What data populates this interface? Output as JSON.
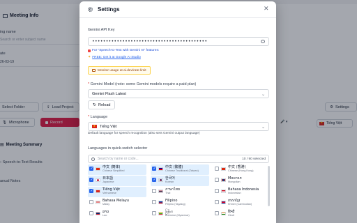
{
  "background": {
    "title": "Meeting Info",
    "name_label": "ing name",
    "name_placeholder": "Search or enter subject name",
    "date_label": "ate",
    "date_value": "26-03-19",
    "select_folder_label": "Select Folder",
    "load_project_label": "Load Project",
    "microphone_label": "Microphone",
    "record_label": "Record",
    "settings_label": "Settings",
    "language_value": "Tiếng Việt",
    "summary_label": "Meeting Summary",
    "stt_label": "Speech-to-Text Results",
    "notes_label": "anual Notes"
  },
  "dialog": {
    "title": "Settings",
    "close_icon": "close-icon",
    "api_key_label": "Gemini API Key",
    "api_key_value": "••••••••••••••••••••••••••••••••••••••••••",
    "api_note_1": "For \"Speech-to-Text with Gemini AI\" features:",
    "api_note_2": "FREE: Get it at Google AI Studio",
    "usage_label": "Monitor usage at ai.dev/rate-limit",
    "model_label": "Gemini Model (note: some Gemini models require a paid plan)",
    "model_value": "Gemini Flash Latest",
    "reload_label": "Reload",
    "language_label": "Language",
    "language_value": "Tiếng Việt",
    "language_hint": "Default language for speech recognition (also sets Gemini output language)",
    "quick_switch_label": "Languages in quick-switch selector",
    "search_placeholder": "Search by name or code...",
    "selected_count": "10 / 90 selected",
    "languages": [
      {
        "name": "中文 (简体)",
        "sub": "Chinese Simplified",
        "selected": true,
        "flag": "cn"
      },
      {
        "name": "中文 (繁體)",
        "sub": "Chinese Traditional (Taiwan)",
        "selected": true,
        "flag": "tw"
      },
      {
        "name": "中文 (香港)",
        "sub": "Chinese (Hong Kong)",
        "selected": false,
        "flag": "hk"
      },
      {
        "name": "日本語",
        "sub": "Japanese",
        "selected": true,
        "flag": "jp"
      },
      {
        "name": "한국어",
        "sub": "Korean",
        "selected": true,
        "flag": "kr"
      },
      {
        "name": "Монгол",
        "sub": "Mongolian",
        "selected": false,
        "flag": "mn"
      },
      {
        "name": "Tiếng Việt",
        "sub": "Vietnamese",
        "selected": true,
        "flag": "vn"
      },
      {
        "name": "ภาษาไทย",
        "sub": "Thai",
        "selected": false,
        "flag": "th"
      },
      {
        "name": "Bahasa Indonesia",
        "sub": "Indonesian",
        "selected": false,
        "flag": "id"
      },
      {
        "name": "Bahasa Melayu",
        "sub": "Malay",
        "selected": false,
        "flag": "my"
      },
      {
        "name": "Filipino",
        "sub": "Filipino (Tagalog)",
        "selected": false,
        "flag": "ph"
      },
      {
        "name": "ភាសាខ្មែរ",
        "sub": "Khmer (Cambodian)",
        "selected": false,
        "flag": "kh"
      },
      {
        "name": "ລາວ",
        "sub": "Lao",
        "selected": false,
        "flag": "la"
      },
      {
        "name": "မြန်မာ",
        "sub": "Burmese (Myanmar)",
        "selected": false,
        "flag": "mm"
      },
      {
        "name": "हिन्दी",
        "sub": "Hindi",
        "selected": false,
        "flag": "in"
      }
    ]
  }
}
